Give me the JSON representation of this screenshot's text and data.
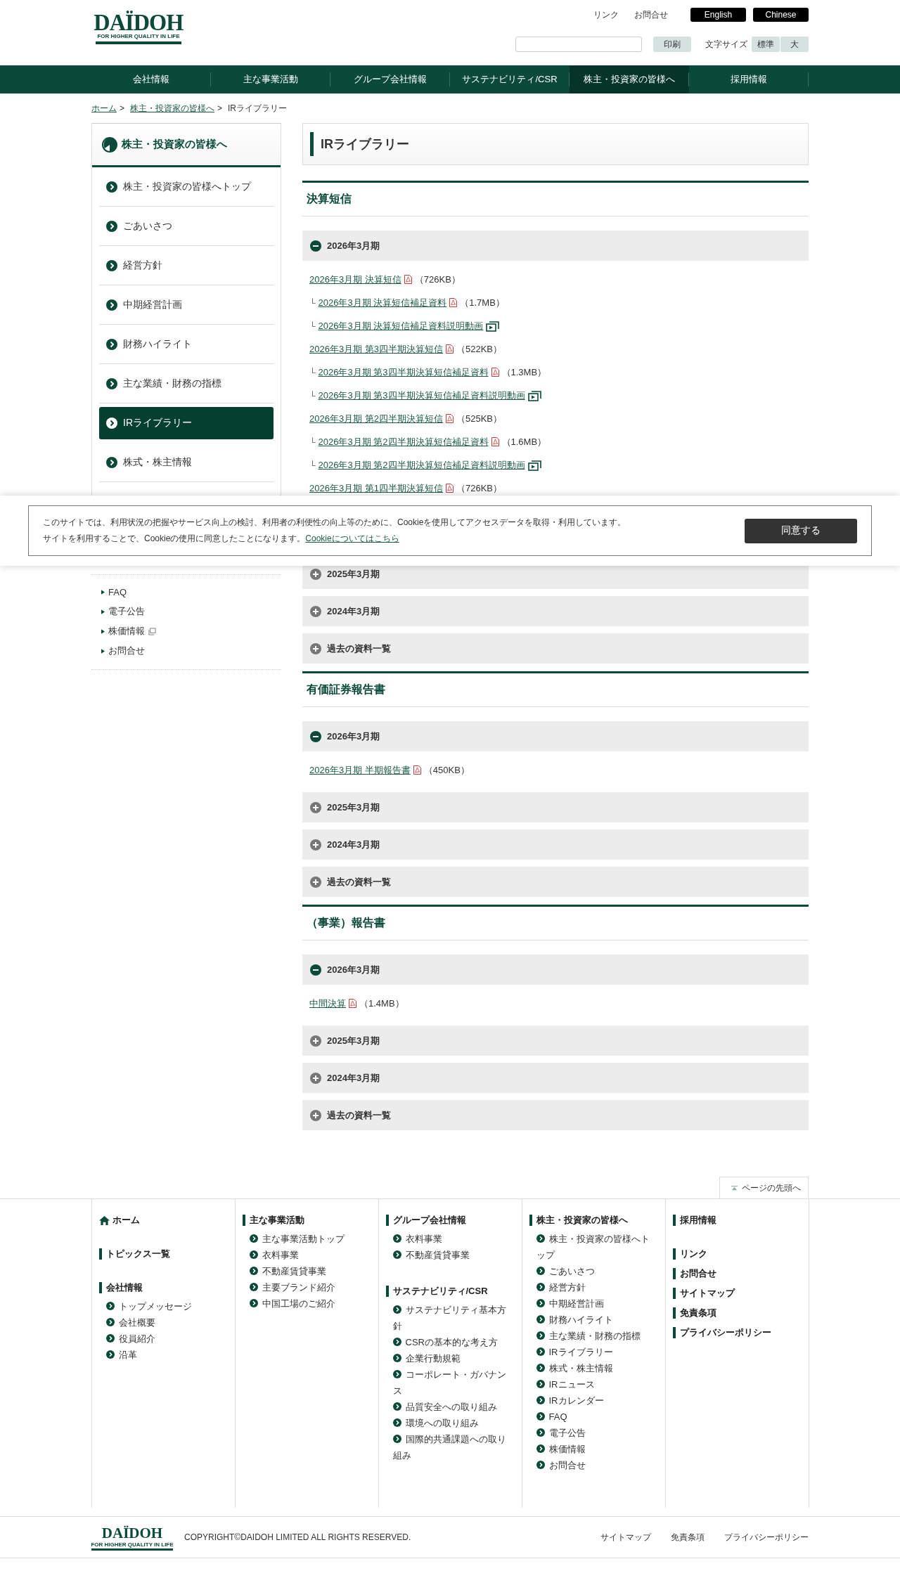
{
  "header": {
    "logo": {
      "name": "DAÏDOH",
      "tagline": "FOR HIGHER QUALITY IN LIFE"
    },
    "top_links": [
      "リンク",
      "お問合せ"
    ],
    "language_buttons": [
      "English",
      "Chinese"
    ],
    "print_button": "印刷",
    "font_size": {
      "label": "文字サイズ",
      "options": [
        "標準",
        "大"
      ]
    }
  },
  "nav": [
    {
      "label": "会社情報",
      "selected": false
    },
    {
      "label": "主な事業活動",
      "selected": false
    },
    {
      "label": "グループ会社情報",
      "selected": false
    },
    {
      "label": "サステナビリティ/CSR",
      "selected": false
    },
    {
      "label": "株主・投資家の皆様へ",
      "selected": true
    },
    {
      "label": "採用情報",
      "selected": false
    }
  ],
  "breadcrumb": {
    "separator": ">",
    "items": [
      {
        "label": "ホーム",
        "kind": "link"
      },
      {
        "label": "株主・投資家の皆様へ",
        "kind": "link"
      },
      {
        "label": "IRライブラリー",
        "kind": "current"
      }
    ]
  },
  "sidebar": {
    "title": "株主・投資家の皆様へ",
    "items": [
      {
        "label": "株主・投資家の皆様へトップ",
        "selected": false
      },
      {
        "label": "ごあいさつ",
        "selected": false
      },
      {
        "label": "経営方針",
        "selected": false
      },
      {
        "label": "中期経営計画",
        "selected": false
      },
      {
        "label": "財務ハイライト",
        "selected": false
      },
      {
        "label": "主な業績・財務の指標",
        "selected": false
      },
      {
        "label": "IRライブラリー",
        "selected": true
      },
      {
        "label": "株式・株主情報",
        "selected": false
      }
    ],
    "sub_links": [
      {
        "label": "FAQ",
        "external": false
      },
      {
        "label": "電子公告",
        "external": false
      },
      {
        "label": "株価情報",
        "external": true
      },
      {
        "label": "お問合せ",
        "external": false
      }
    ]
  },
  "main": {
    "title": "IRライブラリー",
    "sections": [
      {
        "heading": "決算短信",
        "groups": [
          {
            "label": "2026年3月期",
            "expanded": true,
            "files": [
              {
                "label": "2026年3月期 決算短信",
                "kind": "pdf",
                "size": "（726KB）"
              },
              {
                "marker": "└",
                "label": "2026年3月期 決算短信補足資料",
                "kind": "pdf",
                "size": "（1.7MB）"
              },
              {
                "marker": "└",
                "label": "2026年3月期 決算短信補足資料説明動画",
                "kind": "video"
              },
              {
                "label": "2026年3月期 第3四半期決算短信",
                "kind": "pdf",
                "size": "（522KB）"
              },
              {
                "marker": "└",
                "label": "2026年3月期 第3四半期決算短信補足資料",
                "kind": "pdf",
                "size": "（1.3MB）"
              },
              {
                "marker": "└",
                "label": "2026年3月期 第3四半期決算短信補足資料説明動画",
                "kind": "video"
              },
              {
                "label": "2026年3月期 第2四半期決算短信",
                "kind": "pdf",
                "size": "（525KB）"
              },
              {
                "marker": "└",
                "label": "2026年3月期 第2四半期決算短信補足資料",
                "kind": "pdf",
                "size": "（1.6MB）"
              },
              {
                "marker": "└",
                "label": "2026年3月期 第2四半期決算短信補足資料説明動画",
                "kind": "video"
              },
              {
                "label": "2026年3月期 第1四半期決算短信",
                "kind": "pdf",
                "size": "（726KB）"
              }
            ]
          },
          {
            "label": "2025年3月期",
            "expanded": false
          },
          {
            "label": "2024年3月期",
            "expanded": false
          },
          {
            "label": "過去の資料一覧",
            "expanded": false
          }
        ]
      },
      {
        "heading": "有価証券報告書",
        "groups": [
          {
            "label": "2026年3月期",
            "expanded": true,
            "files": [
              {
                "label": "2026年3月期 半期報告書",
                "kind": "pdf",
                "size": "（450KB）"
              }
            ]
          },
          {
            "label": "2025年3月期",
            "expanded": false
          },
          {
            "label": "2024年3月期",
            "expanded": false
          },
          {
            "label": "過去の資料一覧",
            "expanded": false
          }
        ]
      },
      {
        "heading": "（事業）報告書",
        "groups": [
          {
            "label": "2026年3月期",
            "expanded": true,
            "files": [
              {
                "label": "中間決算",
                "kind": "pdf",
                "size": "（1.4MB）"
              }
            ]
          },
          {
            "label": "2025年3月期",
            "expanded": false
          },
          {
            "label": "2024年3月期",
            "expanded": false
          },
          {
            "label": "過去の資料一覧",
            "expanded": false
          }
        ]
      }
    ]
  },
  "cookie_banner": {
    "text": "このサイトでは、利用状況の把握やサービス向上の検討、利用者の利便性の向上等のために、Cookieを使用してアクセスデータを取得・利用しています。",
    "text_2": "サイトを利用することで、Cookieの使用に同意したことになります。",
    "link": "Cookieについてはこちら",
    "button": "同意する"
  },
  "page_top": "ページの先頭へ",
  "footer": {
    "columns": [
      [
        {
          "kind": "home",
          "heading": "ホーム"
        },
        {
          "kind": "section",
          "heading": "トピックス一覧"
        },
        {
          "kind": "section",
          "heading": "会社情報",
          "links": [
            "トップメッセージ",
            "会社概要",
            "役員紹介",
            "沿革"
          ]
        }
      ],
      [
        {
          "kind": "section",
          "heading": "主な事業活動",
          "links": [
            "主な事業活動トップ",
            "衣料事業",
            "不動産賃貸事業",
            "主要ブランド紹介",
            "中国工場のご紹介"
          ]
        }
      ],
      [
        {
          "kind": "section",
          "heading": "グループ会社情報",
          "links": [
            "衣料事業",
            "不動産賃貸事業"
          ]
        },
        {
          "kind": "section",
          "heading": "サステナビリティ/CSR",
          "links": [
            "サステナビリティ基本方針",
            "CSRの基本的な考え方",
            "企業行動規範",
            "コーポレート・ガバナンス",
            "品質安全への取り組み",
            "環境への取り組み",
            "国際的共通課題への取り組み"
          ]
        }
      ],
      [
        {
          "kind": "section",
          "heading": "株主・投資家の皆様へ",
          "links": [
            "株主・投資家の皆様へトップ",
            "ごあいさつ",
            "経営方針",
            "中期経営計画",
            "財務ハイライト",
            "主な業績・財務の指標",
            "IRライブラリー",
            "株式・株主情報",
            "IRニュース",
            "IRカレンダー",
            "FAQ",
            "電子公告",
            "株価情報",
            "お問合せ"
          ]
        }
      ],
      [
        {
          "kind": "section",
          "heading": "採用情報"
        },
        {
          "kind": "headings",
          "items": [
            "リンク",
            "お問合せ",
            "サイトマップ",
            "免責条項",
            "プライバシーポリシー"
          ]
        }
      ]
    ],
    "logo": {
      "name": "DAÏDOH",
      "tagline": "FOR HIGHER QUALITY IN LIFE"
    },
    "copyright": "COPYRIGHT©DAIDOH LIMITED ALL RIGHTS RESERVED.",
    "links": [
      "サイトマップ",
      "免責条項",
      "プライバシーポリシー"
    ]
  }
}
